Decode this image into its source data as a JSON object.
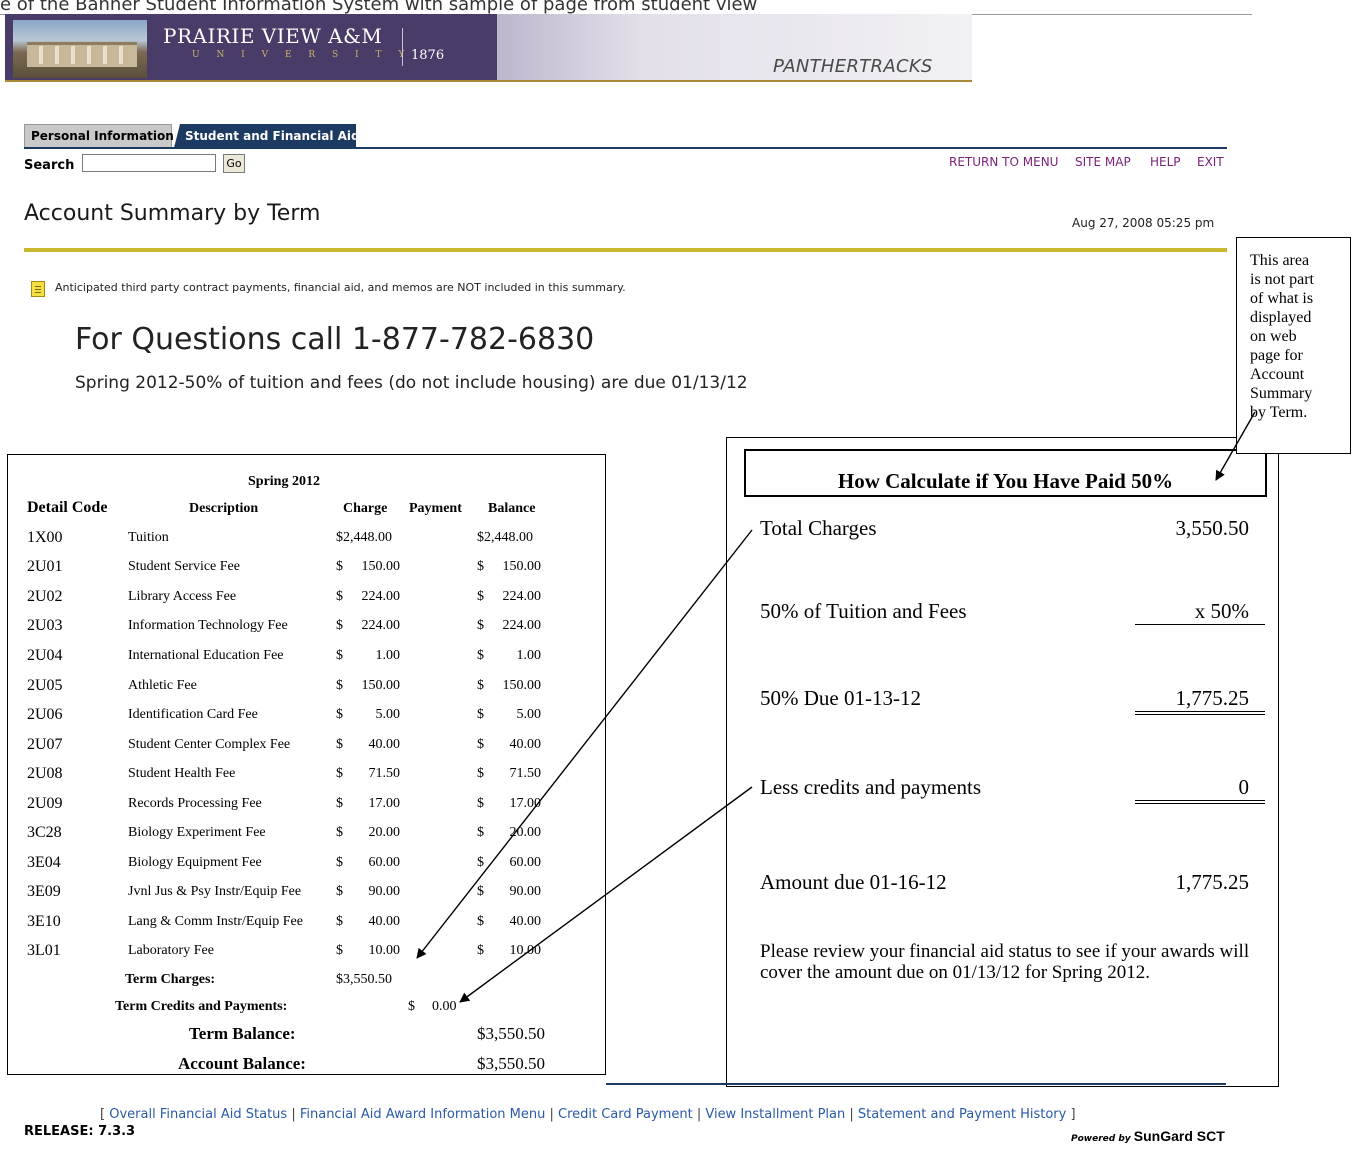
{
  "top_clipped_text": "e of the Banner Student Information System with sample of page from student view",
  "banner": {
    "university_name": "PRAIRIE VIEW A&M",
    "university_sub": "U N I V E R S I T Y",
    "year": "1876",
    "portal_name": "PANTHERTRACKS",
    "colors": {
      "dark": "#4a3c68",
      "gold": "#a88a3a"
    }
  },
  "tabs": [
    {
      "label": "Personal Information",
      "active": false
    },
    {
      "label": "Student and Financial Aid",
      "active": true
    }
  ],
  "search": {
    "label": "Search",
    "value": "",
    "go_label": "Go"
  },
  "top_links": [
    "RETURN TO MENU",
    "SITE MAP",
    "HELP",
    "EXIT"
  ],
  "page_title": "Account Summary by Term",
  "timestamp": "Aug 27, 2008 05:25 pm",
  "info_note": "Anticipated third party contract payments, financial aid, and memos are NOT included in this summary.",
  "questions": "For Questions call 1-877-782-6830",
  "due_note": "Spring 2012-50% of tuition and fees (do not include housing) are due 01/13/12",
  "statement": {
    "term": "Spring 2012",
    "headers": {
      "code": "Detail Code",
      "desc": "Description",
      "charge": "Charge",
      "payment": "Payment",
      "balance": "Balance"
    },
    "rows": [
      {
        "code": "1X00",
        "desc": "Tuition",
        "charge": "$2,448.00",
        "balance": "$2,448.00"
      },
      {
        "code": "2U01",
        "desc": "Student Service Fee",
        "charge": "150.00",
        "balance": "150.00"
      },
      {
        "code": "2U02",
        "desc": "Library Access Fee",
        "charge": "224.00",
        "balance": "224.00"
      },
      {
        "code": "2U03",
        "desc": "Information Technology Fee",
        "charge": "224.00",
        "balance": "224.00"
      },
      {
        "code": "2U04",
        "desc": "International Education Fee",
        "charge": "1.00",
        "balance": "1.00"
      },
      {
        "code": "2U05",
        "desc": "Athletic Fee",
        "charge": "150.00",
        "balance": "150.00"
      },
      {
        "code": "2U06",
        "desc": "Identification Card Fee",
        "charge": "5.00",
        "balance": "5.00"
      },
      {
        "code": "2U07",
        "desc": "Student Center Complex Fee",
        "charge": "40.00",
        "balance": "40.00"
      },
      {
        "code": "2U08",
        "desc": "Student Health Fee",
        "charge": "71.50",
        "balance": "71.50"
      },
      {
        "code": "2U09",
        "desc": "Records Processing Fee",
        "charge": "17.00",
        "balance": "17.00"
      },
      {
        "code": "3C28",
        "desc": "Biology Experiment Fee",
        "charge": "20.00",
        "balance": "20.00"
      },
      {
        "code": "3E04",
        "desc": "Biology Equipment Fee",
        "charge": "60.00",
        "balance": "60.00"
      },
      {
        "code": "3E09",
        "desc": "Jvnl Jus & Psy Instr/Equip Fee",
        "charge": "90.00",
        "balance": "90.00"
      },
      {
        "code": "3E10",
        "desc": "Lang & Comm Instr/Equip Fee",
        "charge": "40.00",
        "balance": "40.00"
      },
      {
        "code": "3L01",
        "desc": "Laboratory Fee",
        "charge": "10.00",
        "balance": "10.00"
      }
    ],
    "dollar_sign": "$",
    "term_charges_label": "Term Charges:",
    "term_charges_value": "$3,550.50",
    "term_credits_label": "Term Credits and Payments:",
    "term_credits_value": "0.00",
    "term_balance_label": "Term Balance:",
    "term_balance_value": "$3,550.50",
    "account_balance_label": "Account Balance:",
    "account_balance_value": "$3,550.50"
  },
  "calc": {
    "title": "How Calculate if You Have Paid 50%",
    "total_label": "Total Charges",
    "total_value": "3,550.50",
    "pct_label": "50% of Tuition and Fees",
    "pct_value": "x 50%",
    "due_label": "50% Due 01-13-12",
    "due_value": "1,775.25",
    "less_label": "Less credits and payments",
    "less_value": "0",
    "amount_label": "Amount due 01-16-12",
    "amount_value": "1,775.25",
    "review": "Please review your financial aid status to see if your awards will cover the amount due on 01/13/12 for Spring 2012."
  },
  "callout_lines": [
    "This area",
    "is not part",
    "of what is",
    "displayed",
    "on web",
    "page for",
    "Account",
    "Summary",
    "by Term."
  ],
  "footer_links": [
    "Overall Financial Aid Status",
    "Financial Aid Award Information Menu",
    "Credit Card Payment",
    "View Installment Plan",
    "Statement and Payment History"
  ],
  "release": "RELEASE: 7.3.3",
  "powered_prefix": "Powered by",
  "powered_brand": "SunGard SCT"
}
